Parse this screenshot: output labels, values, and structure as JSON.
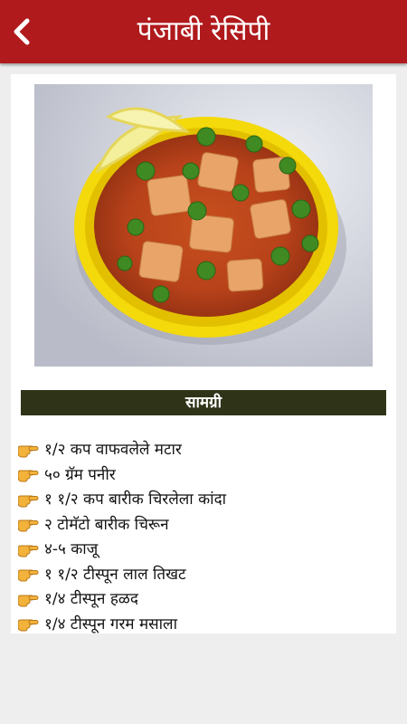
{
  "header": {
    "title": "पंजाबी रेसिपी",
    "back_icon": "chevron-left-icon",
    "background": "#b01a1c"
  },
  "recipe_image": {
    "description": "paneer-peas-curry-photo"
  },
  "ingredients_section": {
    "heading": "सामग्री",
    "bullet_icon": "pointing-hand-icon",
    "items": [
      "१/२ कप वाफवलेले मटार",
      "५० ग्रॅम पनीर",
      "१ १/२ कप बारीक चिरलेला कांदा",
      "२ टोमॅटो बारीक चिरून",
      "४-५ काजू",
      "१ १/२ टीस्पून लाल तिखट",
      "१/४ टीस्पून हळद",
      "१/४ टीस्पून गरम मसाला"
    ]
  }
}
